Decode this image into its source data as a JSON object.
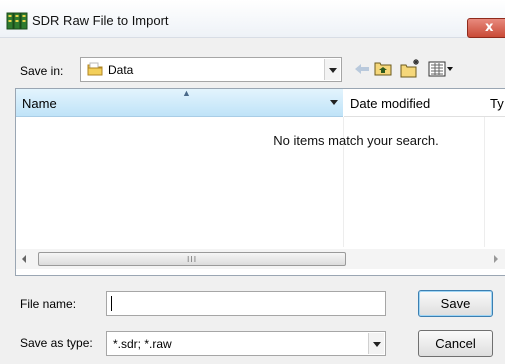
{
  "window": {
    "title": "SDR Raw File to Import",
    "close_glyph": "x"
  },
  "save_in": {
    "label": "Save in:",
    "folder": "Data",
    "folder_icon": "folder-icon"
  },
  "toolbar": {
    "icons": [
      "back-arrow-icon",
      "up-folder-icon",
      "new-folder-icon",
      "view-menu-icon"
    ]
  },
  "file_list": {
    "columns": [
      "Name",
      "Date modified",
      "Ty"
    ],
    "empty_message": "No items match your search.",
    "scrollbar_grip": "III"
  },
  "file_name": {
    "label": "File name:",
    "value": ""
  },
  "save_as_type": {
    "label": "Save as type:",
    "value": "*.sdr; *.raw"
  },
  "buttons": {
    "save": "Save",
    "cancel": "Cancel"
  }
}
